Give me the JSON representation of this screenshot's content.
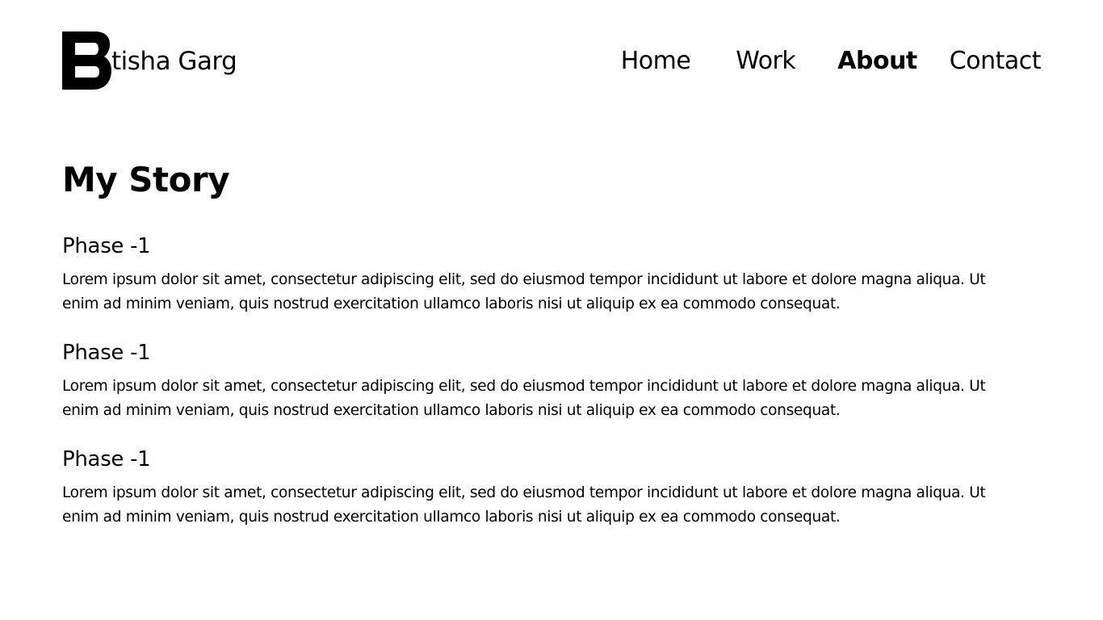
{
  "header": {
    "logo_text": "tisha Garg",
    "nav": {
      "home": "Home",
      "work": "Work",
      "about": "About",
      "contact": "Contact",
      "active": "About"
    }
  },
  "main": {
    "title": "My Story",
    "sections": [
      {
        "title": "Phase -1",
        "body": "Lorem ipsum dolor sit amet, consectetur adipiscing elit, sed do eiusmod tempor incididunt ut labore et dolore magna aliqua. Ut enim ad minim veniam, quis nostrud exercitation ullamco laboris nisi ut aliquip ex ea commodo consequat."
      },
      {
        "title": "Phase -1",
        "body": "Lorem ipsum dolor sit amet, consectetur adipiscing elit, sed do eiusmod tempor incididunt ut labore et dolore magna aliqua. Ut enim ad minim veniam, quis nostrud exercitation ullamco laboris nisi ut aliquip ex ea commodo consequat."
      },
      {
        "title": "Phase -1",
        "body": "Lorem ipsum dolor sit amet, consectetur adipiscing elit, sed do eiusmod tempor incididunt ut labore et dolore magna aliqua. Ut enim ad minim veniam, quis nostrud exercitation ullamco laboris nisi ut aliquip ex ea commodo consequat."
      }
    ]
  },
  "colors": {
    "background": "#ffffff",
    "text": "#000000"
  },
  "icons": {
    "logo": "brand-logo-mark"
  }
}
